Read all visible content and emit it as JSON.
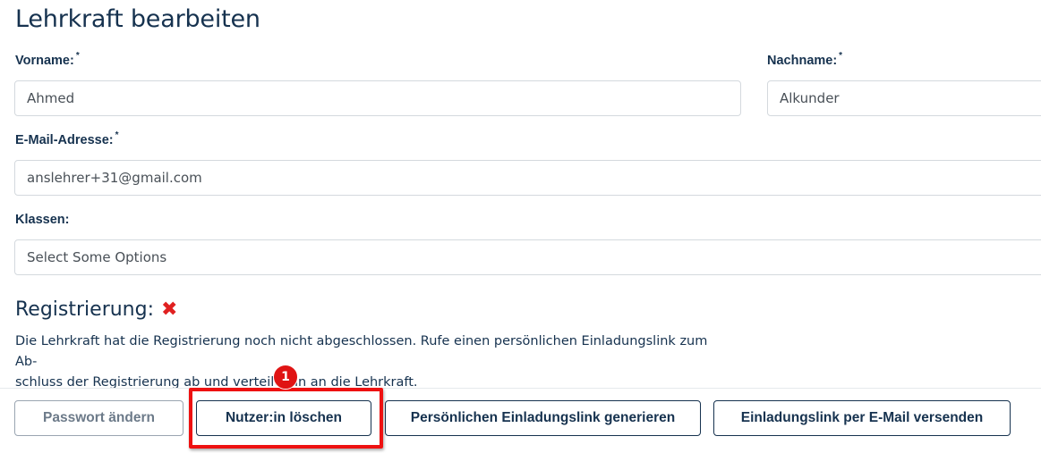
{
  "page_title": "Lehrkraft bearbeiten",
  "fields": {
    "vorname": {
      "label": "Vorname:",
      "required_mark": "*",
      "value": "Ahmed"
    },
    "nachname": {
      "label": "Nachname:",
      "required_mark": "*",
      "value": "Alkunder"
    },
    "email": {
      "label": "E-Mail-Adresse:",
      "required_mark": "*",
      "value": "anslehrer+31@gmail.com"
    },
    "klassen": {
      "label": "Klassen:",
      "placeholder": "Select Some Options"
    }
  },
  "registration": {
    "title": "Registrierung:",
    "status_icon": "x-icon",
    "status_glyph": "✖",
    "description_line1": "Die Lehrkraft hat die Registrierung noch nicht abgeschlossen. Rufe einen persönlichen Einladungslink zum Ab-",
    "description_line2": "schluss der Registrierung ab und verteile ihn an die Lehrkraft."
  },
  "buttons": {
    "password": "Passwort ändern",
    "delete_user": "Nutzer:in löschen",
    "generate_link": "Persönlichen Einladungslink generieren",
    "send_link": "Einladungslink per E-Mail versenden"
  },
  "annotation": {
    "step_number": "1",
    "color": "#e01414"
  },
  "colors": {
    "text": "#16324f",
    "error": "#e02020",
    "border": "#d4d9de"
  }
}
